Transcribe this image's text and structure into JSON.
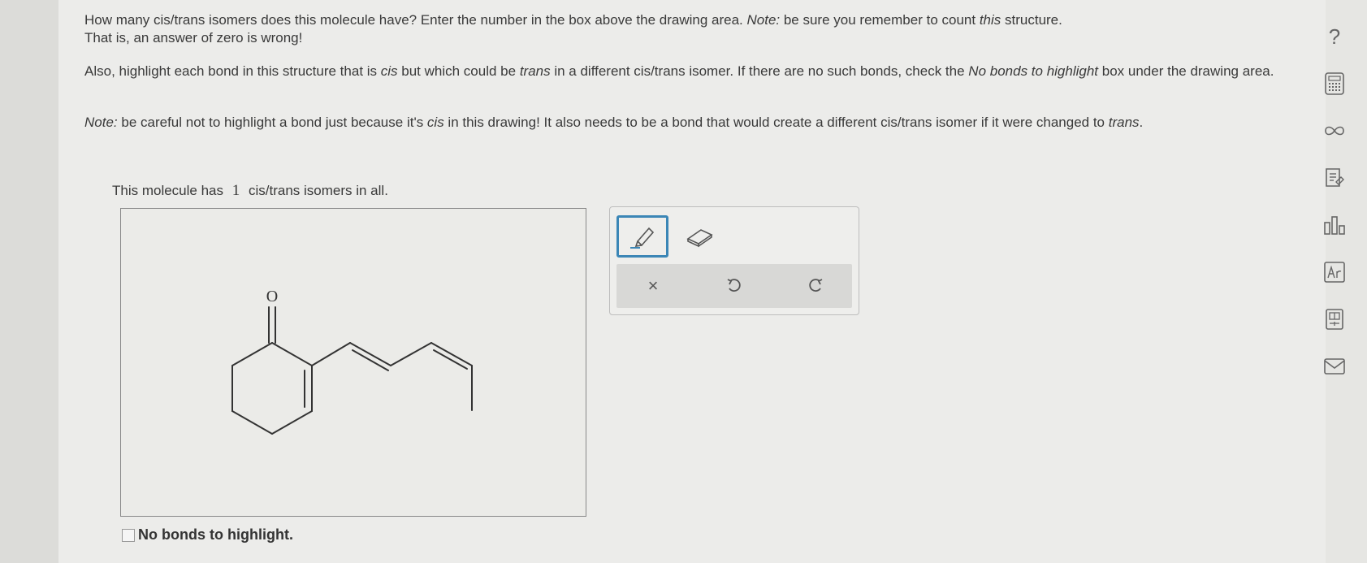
{
  "question": {
    "p1_a": "How many cis/trans isomers does this molecule have? Enter the number in the box above the drawing area. ",
    "p1_note": "Note:",
    "p1_b": " be sure you remember to count ",
    "p1_this": "this",
    "p1_c": " structure.",
    "p1_line2": "That is, an answer of zero is wrong!",
    "p2_a": "Also, highlight each bond in this structure that is ",
    "p2_cis": "cis",
    "p2_b": " but which could be ",
    "p2_trans": "trans",
    "p2_c": " in a different cis/trans isomer. If there are no such bonds, check the ",
    "p2_nobonds": "No bonds to highlight",
    "p2_d": " box under the drawing area.",
    "p3_note": "Note:",
    "p3_a": " be careful not to highlight a bond just because it's ",
    "p3_cis": "cis",
    "p3_b": " in this drawing! It also needs to be a bond that would create a different cis/trans isomer if it were changed to ",
    "p3_trans": "trans",
    "p3_c": "."
  },
  "answer": {
    "prefix": "This molecule has",
    "value": "1",
    "suffix": "cis/trans isomers in all."
  },
  "molecule": {
    "atom_label": "O"
  },
  "tools": {
    "pencil": "pencil-icon",
    "eraser": "eraser-icon",
    "clear": "×",
    "undo": "undo-icon",
    "redo": "redo-icon"
  },
  "checkbox": {
    "label": "No bonds to highlight.",
    "checked": false
  },
  "sidebar": {
    "help": "?",
    "items": [
      "calculator-icon",
      "infinity-icon",
      "notes-icon",
      "chart-icon",
      "periodic-table-icon",
      "ruler-icon",
      "mail-icon"
    ]
  },
  "colors": {
    "accent": "#3b86b6",
    "background": "#ececea"
  }
}
